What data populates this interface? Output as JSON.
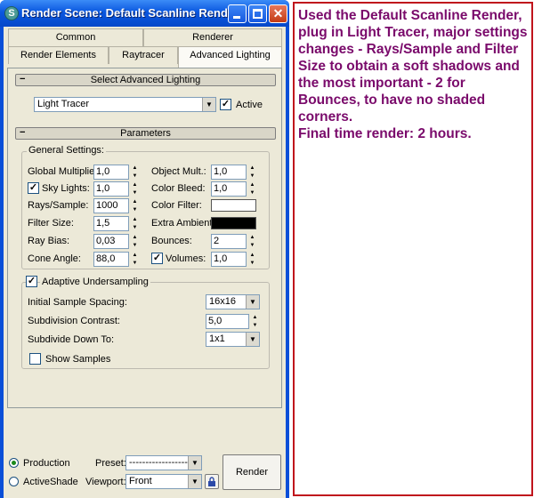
{
  "window": {
    "title": "Render Scene: Default Scanline Rende...",
    "icon_name": "3dsmax-s-icon",
    "icon_letter": "S"
  },
  "tabs_row1": [
    "Common",
    "Renderer"
  ],
  "tabs_row2": [
    "Render Elements",
    "Raytracer",
    "Advanced Lighting"
  ],
  "active_tab": "Advanced Lighting",
  "advanced_lighting": {
    "rollout_title": "Select Advanced Lighting",
    "plugin": "Light Tracer",
    "active_label": "Active",
    "active_checked": true
  },
  "parameters": {
    "rollout_title": "Parameters",
    "general_title": "General Settings:",
    "global_multiplier": {
      "label": "Global Multiplier:",
      "value": "1,0"
    },
    "object_mult": {
      "label": "Object Mult.:",
      "value": "1,0"
    },
    "sky_lights": {
      "label": "Sky Lights:",
      "value": "1,0",
      "checked": true
    },
    "color_bleed": {
      "label": "Color Bleed:",
      "value": "1,0"
    },
    "rays_sample": {
      "label": "Rays/Sample:",
      "value": "1000"
    },
    "color_filter": {
      "label": "Color Filter:",
      "color": "#ffffff"
    },
    "filter_size": {
      "label": "Filter Size:",
      "value": "1,5"
    },
    "extra_ambient": {
      "label": "Extra Ambient:",
      "color": "#000000"
    },
    "ray_bias": {
      "label": "Ray Bias:",
      "value": "0,03"
    },
    "bounces": {
      "label": "Bounces:",
      "value": "2"
    },
    "cone_angle": {
      "label": "Cone Angle:",
      "value": "88,0"
    },
    "volumes": {
      "label": "Volumes:",
      "value": "1,0",
      "checked": true
    }
  },
  "adaptive": {
    "title": "Adaptive Undersampling",
    "checked": true,
    "initial_spacing": {
      "label": "Initial Sample Spacing:",
      "value": "16x16"
    },
    "subdivision_contrast": {
      "label": "Subdivision Contrast:",
      "value": "5,0"
    },
    "subdivide_down_to": {
      "label": "Subdivide Down To:",
      "value": "1x1"
    },
    "show_samples": {
      "label": "Show Samples",
      "checked": false
    }
  },
  "footer": {
    "production_label": "Production",
    "activeshade_label": "ActiveShade",
    "selected_mode": "Production",
    "preset_label": "Preset:",
    "preset_value": "----------------------",
    "viewport_label": "Viewport:",
    "viewport_value": "Front",
    "render_label": "Render"
  },
  "annotation": {
    "paragraph1": "Used the Default Scanline Render, plug in Light Tracer, major settings changes - Rays/Sample and Filter Size to obtain a soft shadows and the most important - 2 for Bounces, to have no shaded corners.",
    "paragraph2": "Final time render: 2 hours."
  },
  "colors": {
    "titlebar": "#0a57df",
    "dialog_bg": "#ece9d8",
    "annotation_border": "#c0141c",
    "annotation_text": "#7a0a6b"
  }
}
